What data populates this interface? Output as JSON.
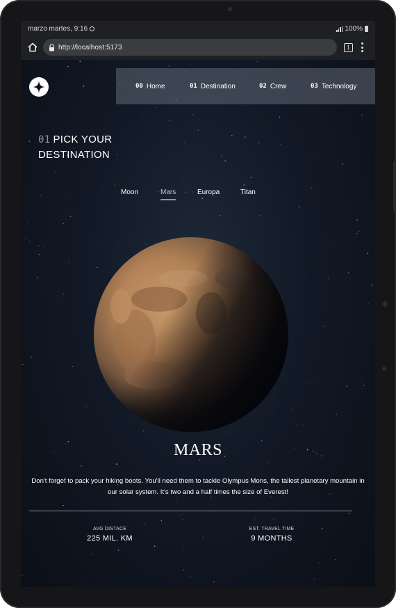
{
  "status_bar": {
    "time_text": "marzo martes, 9:16",
    "battery": "100%"
  },
  "browser": {
    "url": "http://localhost:5173",
    "tab_count": "1"
  },
  "nav": {
    "items": [
      {
        "num": "00",
        "label": "Home"
      },
      {
        "num": "01",
        "label": "Destination"
      },
      {
        "num": "02",
        "label": "Crew"
      },
      {
        "num": "03",
        "label": "Technology"
      }
    ]
  },
  "heading": {
    "num": "01",
    "line1": "PICK YOUR",
    "line2": "DESTINATION"
  },
  "destinations": {
    "tabs": [
      "Moon",
      "Mars",
      "Europa",
      "Titan"
    ],
    "active": "Mars"
  },
  "planet": {
    "name": "MARS",
    "description": "Don't forget to pack your hiking boots. You'll need them to tackle Olympus Mons, the tallest planetary mountain in our solar system. It's two and a half times the size of Everest!",
    "stats": [
      {
        "label": "AVG DISTACE",
        "value": "225 MIL. KM"
      },
      {
        "label": "EST. TRAVEL TIME",
        "value": "9 MONTHS"
      }
    ]
  },
  "colors": {
    "page_background": "#0b0f17",
    "navbar": "#606876",
    "active_tab_underline": "#8e96a3",
    "mars_surface": "#b9875a"
  },
  "icons": [
    "home-icon",
    "lock-icon",
    "tabs-icon",
    "menu-icon",
    "star-logo-icon",
    "signal-icon",
    "battery-icon",
    "data-saver-icon"
  ]
}
